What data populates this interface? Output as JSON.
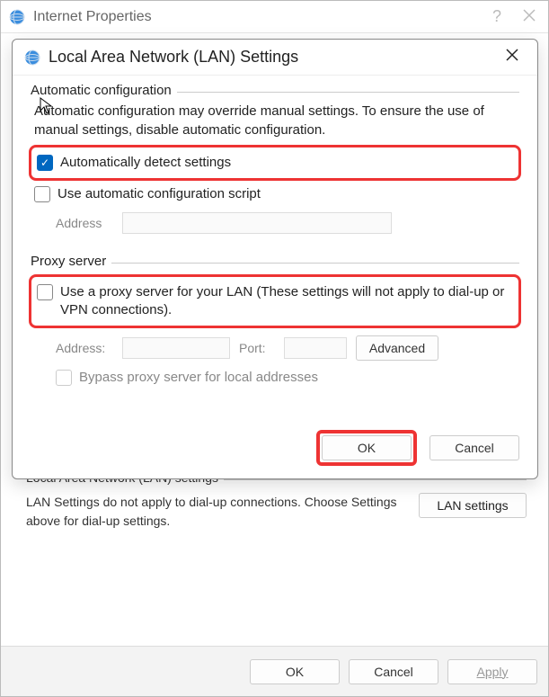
{
  "parent": {
    "title": "Internet Properties",
    "lan_group_label": "Local Area Network (LAN) settings",
    "lan_text": "LAN Settings do not apply to dial-up connections. Choose Settings above for dial-up settings.",
    "lan_button": "LAN settings",
    "footer": {
      "ok": "OK",
      "cancel": "Cancel",
      "apply": "Apply"
    }
  },
  "dialog": {
    "title": "Local Area Network (LAN) Settings",
    "auto": {
      "group_label": "Automatic configuration",
      "desc": "Automatic configuration may override manual settings.  To ensure the use of manual settings, disable automatic configuration.",
      "detect_label": "Automatically detect settings",
      "script_label": "Use automatic configuration script",
      "address_label": "Address"
    },
    "proxy": {
      "group_label": "Proxy server",
      "use_label": "Use a proxy server for your LAN (These settings will not apply to dial-up or VPN connections).",
      "address_label": "Address:",
      "port_label": "Port:",
      "advanced": "Advanced",
      "bypass_label": "Bypass proxy server for local addresses"
    },
    "footer": {
      "ok": "OK",
      "cancel": "Cancel"
    }
  }
}
